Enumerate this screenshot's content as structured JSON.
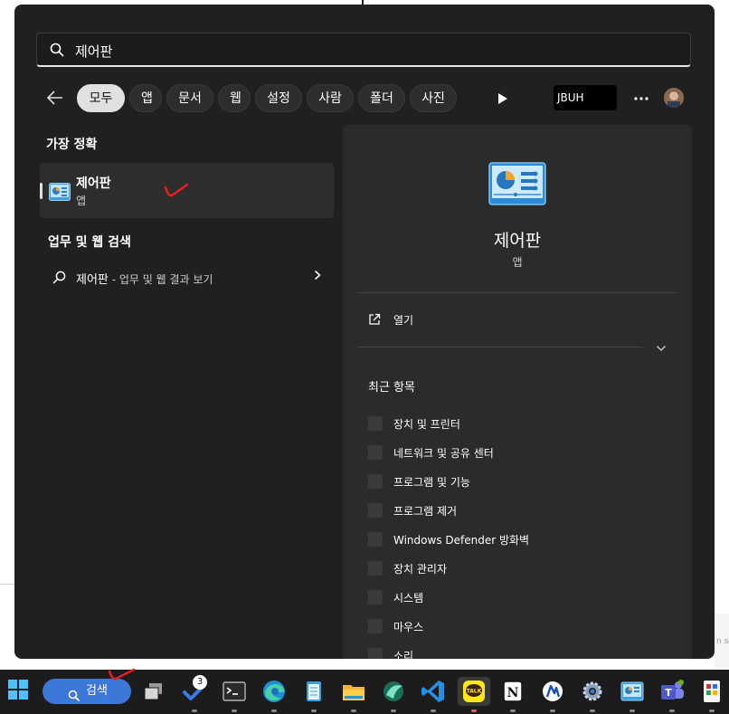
{
  "search": {
    "query": "제어판"
  },
  "filters": [
    "모두",
    "앱",
    "문서",
    "웹",
    "설정",
    "사람",
    "폴더",
    "사진"
  ],
  "account_label": "JBUH",
  "best_match": {
    "title": "가장 정확",
    "name": "제어판",
    "type": "앱"
  },
  "web_search": {
    "title": "업무 및 웹 검색",
    "query": "제어판",
    "suffix": " - 업무 및 웹 결과 보기"
  },
  "detail": {
    "name": "제어판",
    "type": "앱",
    "open_label": "열기",
    "recent_title": "최근 항목",
    "recent_items": [
      "장치 및 프린터",
      "네트워크 및 공유 센터",
      "프로그램 및 기능",
      "프로그램 제거",
      "Windows Defender 방화벽",
      "장치 관리자",
      "시스템",
      "마우스",
      "소리"
    ]
  },
  "taskbar": {
    "search_label": "검색",
    "todo_badge": "3"
  },
  "background": {
    "edge_text": "n sc"
  },
  "icons": [
    "search-icon",
    "back-arrow-icon",
    "play-icon",
    "more-icon",
    "avatar",
    "control-panel-icon",
    "chevron-right-icon",
    "open-external-icon",
    "chevron-down-icon",
    "windows-start-icon",
    "task-view-icon",
    "todo-icon",
    "terminal-icon",
    "edge-icon",
    "notepad-icon",
    "file-explorer-icon",
    "vscode-icon",
    "kakaotalk-icon",
    "notion-icon",
    "settings-icon",
    "teams-icon"
  ],
  "colors": {
    "panel": "#202020",
    "detail_panel": "#2b2b2b",
    "taskbar": "#1c1c1c",
    "search_pill": "#3c78d8",
    "annotation": "#e02020"
  }
}
